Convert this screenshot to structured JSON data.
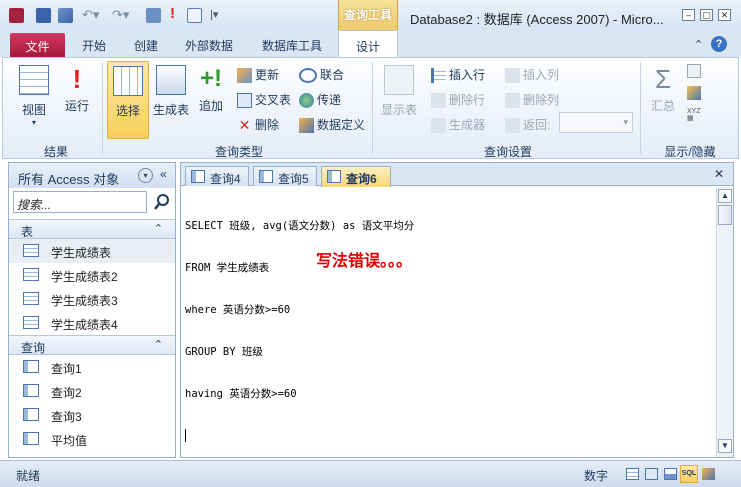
{
  "window": {
    "title": "Database2 : 数据库 (Access 2007) - Micro...",
    "context_tab": "查询工具"
  },
  "tabs": {
    "file": "文件",
    "items": [
      "开始",
      "创建",
      "外部数据",
      "数据库工具"
    ],
    "design": "设计"
  },
  "ribbon": {
    "groups": {
      "results": "结果",
      "query_type": "查询类型",
      "query_setup": "查询设置",
      "show_hide": "显示/隐藏"
    },
    "buttons": {
      "view": "视图",
      "run": "运行",
      "select": "选择",
      "make_table": "生成表",
      "append": "追加",
      "update": "更新",
      "crosstab": "交叉表",
      "delete": "删除",
      "union": "联合",
      "pass_through": "传递",
      "data_definition": "数据定义",
      "show_table": "显示表",
      "insert_rows": "插入行",
      "delete_rows": "删除行",
      "builder": "生成器",
      "insert_columns": "插入列",
      "delete_columns": "删除列",
      "return": "返回:",
      "totals": "汇总"
    }
  },
  "nav": {
    "header": "所有 Access 对象",
    "search_placeholder": "搜索...",
    "sections": [
      {
        "label": "表",
        "items": [
          "学生成绩表",
          "学生成绩表2",
          "学生成绩表3",
          "学生成绩表4"
        ]
      },
      {
        "label": "查询",
        "items": [
          "查询1",
          "查询2",
          "查询3",
          "平均值"
        ]
      }
    ]
  },
  "doc": {
    "tabs": [
      "查询4",
      "查询5",
      "查询6"
    ],
    "active_tab": "查询6",
    "sql_lines": [
      "SELECT 班级, avg(语文分数) as 语文平均分",
      "FROM 学生成绩表",
      "where 英语分数>=60",
      "GROUP BY 班级",
      "having 英语分数>=60"
    ],
    "annotation": "写法错误。。。"
  },
  "status": {
    "left": "就绪",
    "mode": "数字",
    "sql_view": "SQL"
  },
  "colors": {
    "file_tab": "#b8224c",
    "accent": "#1e395b",
    "annotation": "#e00000"
  }
}
